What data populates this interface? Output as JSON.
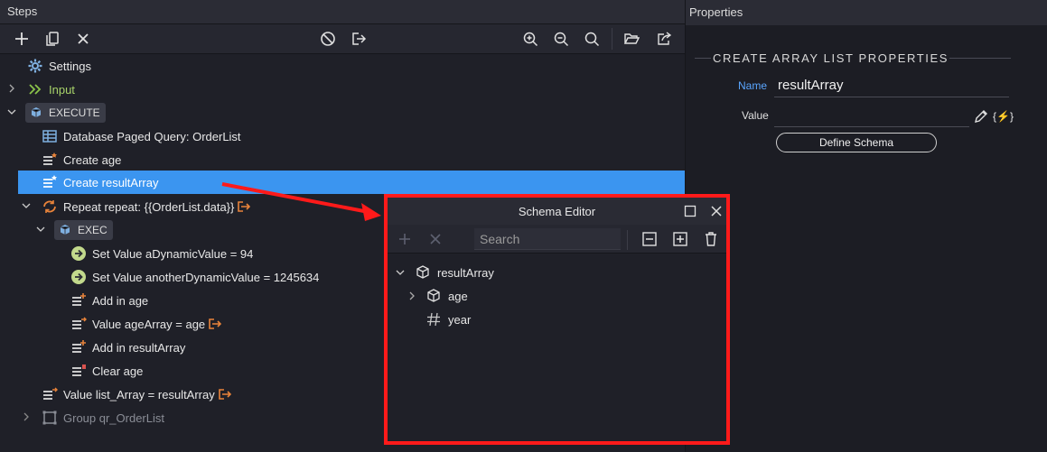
{
  "steps": {
    "title": "Steps",
    "tree": {
      "settings": "Settings",
      "input": "Input",
      "execute": "EXECUTE",
      "db_query": "Database Paged Query: OrderList",
      "create_age": "Create age",
      "create_result_array": "Create resultArray",
      "repeat": "Repeat repeat: {{OrderList.data}}",
      "exec": "EXEC",
      "set_value_1": "Set Value aDynamicValue = 94",
      "set_value_2": "Set Value anotherDynamicValue = 1245634",
      "add_in_age": "Add in age",
      "value_age_array": "Value ageArray = age",
      "add_in_result_array": "Add in resultArray",
      "clear_age": "Clear age",
      "value_list_array": "Value list_Array = resultArray",
      "group": "Group qr_OrderList"
    }
  },
  "properties": {
    "title": "Properties",
    "section_title": "CREATE ARRAY LIST PROPERTIES",
    "name_label": "Name",
    "name_value": "resultArray",
    "value_label": "Value",
    "value_value": "",
    "dynamic_label": "{⚡}",
    "define_schema_label": "Define Schema"
  },
  "schema_editor": {
    "title": "Schema Editor",
    "search_placeholder": "Search",
    "tree": {
      "root": "resultArray",
      "child_object": "age",
      "child_number": "year"
    }
  },
  "colors": {
    "selection": "#3b95f0",
    "highlight_border": "#ff1a1a",
    "accent_green": "#8bc34a",
    "accent_orange": "#e8833a",
    "name_label": "#5aa6ff"
  },
  "icons": {
    "toolbar": [
      "plus-icon",
      "copy-icon",
      "close-icon",
      "disable-icon",
      "export-icon",
      "zoom-in-icon",
      "zoom-out-icon",
      "search-icon",
      "folder-open-icon",
      "share-icon"
    ]
  }
}
